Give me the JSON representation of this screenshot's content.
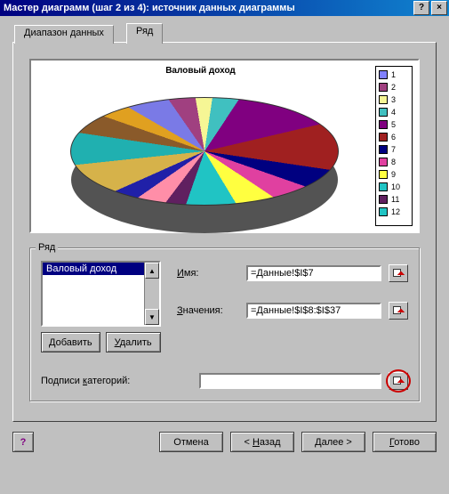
{
  "window": {
    "title": "Мастер диаграмм (шаг 2 из 4): источник данных диаграммы",
    "help_icon": "?",
    "close_icon": "×"
  },
  "tabs": {
    "range": "Диапазон данных",
    "series": "Ряд"
  },
  "chart_data": {
    "type": "pie",
    "title": "Валовый доход",
    "categories": [
      "1",
      "2",
      "3",
      "4",
      "5",
      "6",
      "7",
      "8",
      "9",
      "10",
      "11",
      "12"
    ],
    "values": [
      7,
      7,
      5,
      7,
      12,
      6,
      3,
      4,
      7,
      14,
      5,
      5,
      3,
      5,
      4,
      3,
      3
    ],
    "colors": [
      "#7a7ae6",
      "#a04080",
      "#f6f695",
      "#40c0c0",
      "#800080",
      "#a02020",
      "#000080",
      "#e040a0",
      "#ffff40",
      "#20c4c4",
      "#602060",
      "#ff8ea8",
      "#2020a8",
      "#d6b24a",
      "#20b0b0",
      "#8a5a2a",
      "#e0a020"
    ],
    "legend_colors": [
      "#8080ff",
      "#a04080",
      "#f6f695",
      "#40c0c0",
      "#800080",
      "#a02020",
      "#000080",
      "#e040a0",
      "#ffff40",
      "#20c4c4",
      "#602060",
      "#20c4c4"
    ]
  },
  "group": {
    "label": "Ряд",
    "list": [
      "Валовый доход"
    ],
    "selected": 0,
    "add_label": "Добавить",
    "remove_label": "Удалить",
    "name_label": "Имя:",
    "name_value": "=Данные!$I$7",
    "values_label": "Значения:",
    "values_value": "=Данные!$I$8:$I$37",
    "categories_label": "Подписи категорий:",
    "categories_value": ""
  },
  "footer": {
    "help": "?",
    "cancel": "Отмена",
    "back": "< Назад",
    "next": "Далее >",
    "finish": "Готово"
  }
}
